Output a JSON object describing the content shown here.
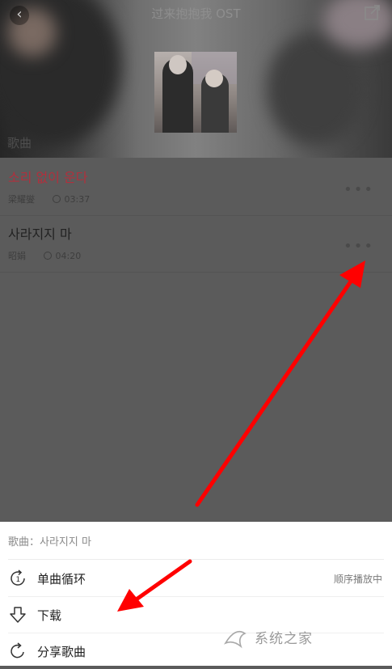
{
  "header": {
    "title": "过来抱抱我 OST",
    "back_icon": "back-icon",
    "share_icon": "share-icon",
    "section_label": "歌曲"
  },
  "songs": [
    {
      "name": "소리 없이 운다",
      "artist": "梁耀燮",
      "duration": "03:37",
      "active": true
    },
    {
      "name": "사라지지 마",
      "artist": "昭娟",
      "duration": "04:20",
      "active": false
    }
  ],
  "sheet": {
    "song_label": "歌曲：사라지지 마",
    "items": [
      {
        "label": "单曲循环",
        "icon": "repeat-one-icon",
        "status": "顺序播放中"
      },
      {
        "label": "下载",
        "icon": "download-icon",
        "status": ""
      },
      {
        "label": "分享歌曲",
        "icon": "share-song-icon",
        "status": ""
      }
    ]
  },
  "watermark": "系统之家",
  "colors": {
    "active_song": "#b0303d",
    "arrow": "#ff0000",
    "overlay": "#5b5b5b"
  }
}
